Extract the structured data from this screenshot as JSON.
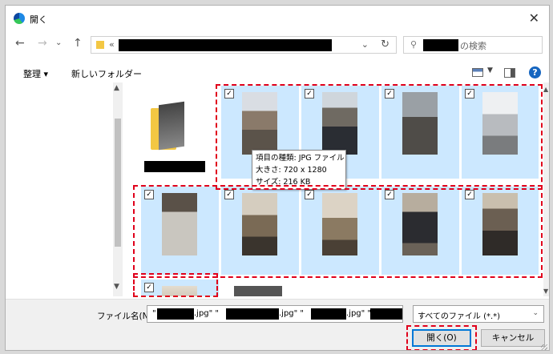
{
  "window": {
    "title": "開く",
    "close": "✕"
  },
  "nav": {
    "back": "←",
    "forward": "→",
    "recent": "⌄",
    "up": "↑",
    "chevron": "«",
    "dropdown": "⌄",
    "refresh": "↻"
  },
  "search": {
    "icon": "⚲",
    "label": "の検索"
  },
  "toolbar": {
    "organize": "整理 ▾",
    "new_folder": "新しいフォルダー",
    "help": "?"
  },
  "tooltip": {
    "type": "項目の種類: JPG ファイル",
    "dimensions": "大きさ: 720 x 1280",
    "size": "サイズ: 216 KB"
  },
  "footer": {
    "filename_label": "ファイル名(N):",
    "filename_parts": [
      "\"",
      ".jpg\" \"",
      ".jpg\" \"",
      ".jpg\" \""
    ],
    "filetype": "すべてのファイル (*.*)",
    "filetype_chevron": "⌄",
    "open": "開く(O)",
    "cancel": "キャンセル"
  },
  "checkmark": "✓",
  "colors": {
    "selection": "#cce8ff",
    "highlight_box": "#e0001b",
    "primary_border": "#0078d7"
  },
  "icons": [
    "edge-icon",
    "folder-icon",
    "view-menu-icon",
    "preview-pane-icon",
    "help-icon"
  ]
}
